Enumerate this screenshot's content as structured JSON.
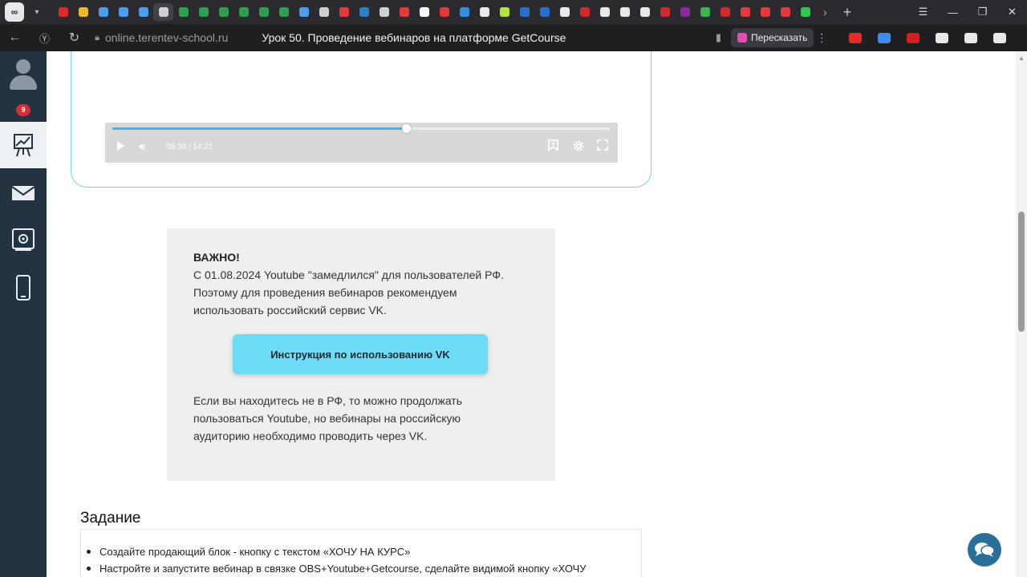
{
  "browser": {
    "app_menu_label": "∞",
    "url_domain": "online.terentev-school.ru",
    "page_title": "Урок 50. Проведение вебинаров на платформе GetCourse",
    "retell_label": "Пересказать",
    "pinned_tab_colors": [
      "#e02a2a",
      "#e8b92c",
      "#4a9df0",
      "#4a9df0",
      "#4a9df0",
      "#cfcfcf",
      "#2e9e4f",
      "#2e9e4f",
      "#2e9e4f",
      "#2e9e4f",
      "#2e9e4f",
      "#2e9e4f",
      "#4a9df0",
      "#cfcfcf",
      "#e53a3a",
      "#2f7ec8",
      "#cfcfcf",
      "#e53a3a",
      "#ffffff",
      "#e03a3a",
      "#2f8ee8",
      "#e8e8e8",
      "#b8e03a",
      "#2a6fd0",
      "#2a6fd0",
      "#e8e8e8",
      "#d02a2a",
      "#e8e8e8",
      "#e8e8e8",
      "#e8e8e8",
      "#d02a2a",
      "#8a2a9e",
      "#3ab54a",
      "#d02a2a",
      "#e53a3a",
      "#e53a3a",
      "#e53a3a",
      "#2ec84a",
      "#f2c12e"
    ],
    "extension_colors": [
      "#e52d27",
      "#3a8ef0",
      "#d21f1f",
      "#e8e8e8",
      "#e8e8e8",
      "#e8e8e8"
    ]
  },
  "sidebar": {
    "badge_count": "9",
    "items": [
      {
        "name": "dashboard",
        "active": true
      },
      {
        "name": "messages",
        "active": false
      },
      {
        "name": "settings",
        "active": false
      },
      {
        "name": "mobile",
        "active": false
      }
    ]
  },
  "player": {
    "time": "08:30 / 14:21",
    "progress": 0.59
  },
  "notice": {
    "title": "ВАЖНО!",
    "line1": "С 01.08.2024 Youtube \"замедлился\" для пользователей РФ.",
    "line2": "Поэтому для проведения вебинаров рекомендуем использовать российский сервис VK.",
    "button_label": "Инструкция по использованию VK",
    "footer": "Если вы находитесь не в РФ, то можно продолжать пользоваться Youtube, но вебинары на российскую аудиторию необходимо проводить через VK."
  },
  "task": {
    "heading": "Задание",
    "items": [
      "Создайте продающий блок - кнопку с текстом «ХОЧУ НА КУРС»",
      "Настройте и запустите вебинар в связке OBS+Youtube+Getcourse, сделайте видимой кнопку «ХОЧУ"
    ]
  },
  "colors": {
    "accent": "#39b6ec",
    "button": "#6ddcf7",
    "sidebar": "#233341",
    "badge": "#d32f3a"
  }
}
